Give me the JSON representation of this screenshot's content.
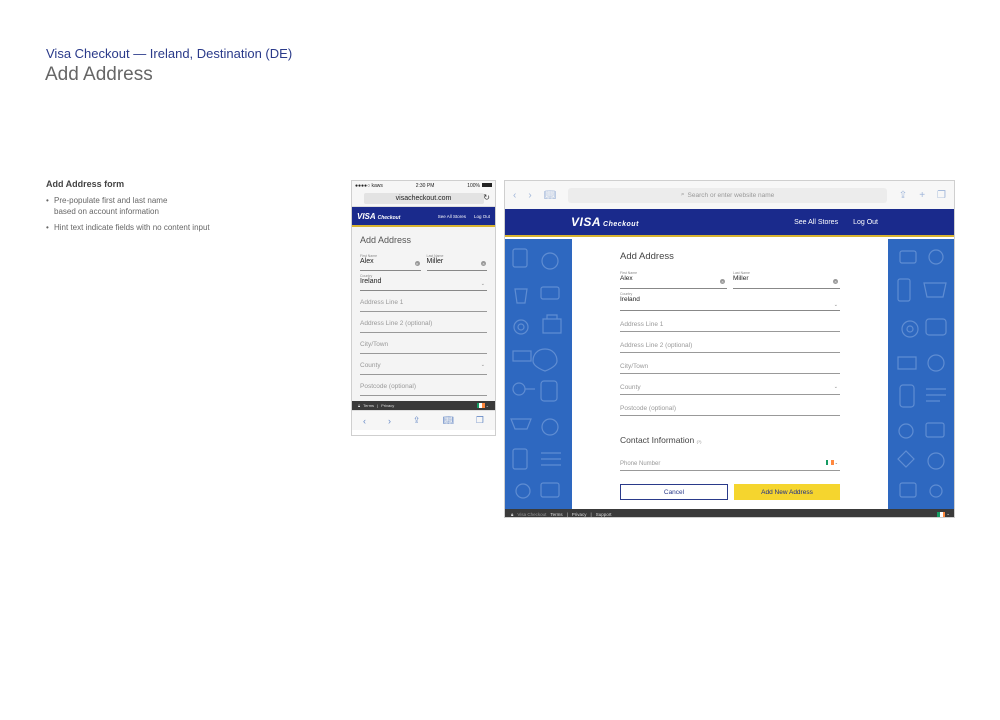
{
  "document": {
    "subtitle": "Visa Checkout — Ireland, Destination (DE)",
    "title": "Add Address"
  },
  "notes": {
    "heading": "Add Address form",
    "bullets": [
      "Pre-populate first and last name",
      "based on account information",
      "Hint text indicate fields with no content input"
    ]
  },
  "phone": {
    "status": {
      "carrier": "●●●●○ kaws",
      "time": "2:30 PM",
      "battery": "100%"
    },
    "url": "visacheckout.com",
    "brand": {
      "visa": "VISA",
      "checkout": "Checkout"
    },
    "nav": {
      "see_all": "See All Stores",
      "logout": "Log Out"
    },
    "form": {
      "title": "Add Address",
      "first_label": "First Name",
      "first_value": "Alex",
      "last_label": "Last Name",
      "last_value": "Miller",
      "country_label": "Country",
      "country_value": "Ireland",
      "address1": "Address Line 1",
      "address2": "Address Line 2 (optional)",
      "city": "City/Town",
      "county": "County",
      "postcode": "Postcode (optional)"
    },
    "footer": {
      "terms": "Terms",
      "sep": "|",
      "privacy": "Privacy"
    }
  },
  "tablet": {
    "search_placeholder": "Search or enter website name",
    "brand": {
      "visa": "VISA",
      "checkout": "Checkout"
    },
    "nav": {
      "see_all": "See All Stores",
      "logout": "Log Out"
    },
    "form": {
      "title": "Add Address",
      "first_label": "First Name",
      "first_value": "Alex",
      "last_label": "Last Name",
      "last_value": "Miller",
      "country_label": "Country",
      "country_value": "Ireland",
      "address1": "Address Line 1",
      "address2": "Address Line 2 (optional)",
      "city": "City/Town",
      "county": "County",
      "postcode": "Postcode (optional)",
      "contact_title": "Contact Information",
      "contact_hint": "(?)",
      "phone": "Phone Number",
      "cancel": "Cancel",
      "add": "Add New Address"
    },
    "footer": {
      "brand": "Visa Checkout",
      "terms": "Terms",
      "sep": "|",
      "privacy": "Privacy",
      "support": "Support"
    }
  },
  "colors": {
    "brand_blue": "#1a2a8c",
    "brand_gold": "#d8b330",
    "button_yellow": "#f5d52e",
    "pattern_blue": "#2e68c0"
  },
  "icons": [
    "wifi-icon",
    "battery-icon",
    "reload-icon",
    "clear-icon",
    "chevron-down-icon",
    "ireland-flag-icon",
    "back-icon",
    "forward-icon",
    "share-icon",
    "bookmarks-icon",
    "tabs-icon",
    "search-icon",
    "add-tab-icon",
    "lock-icon"
  ]
}
